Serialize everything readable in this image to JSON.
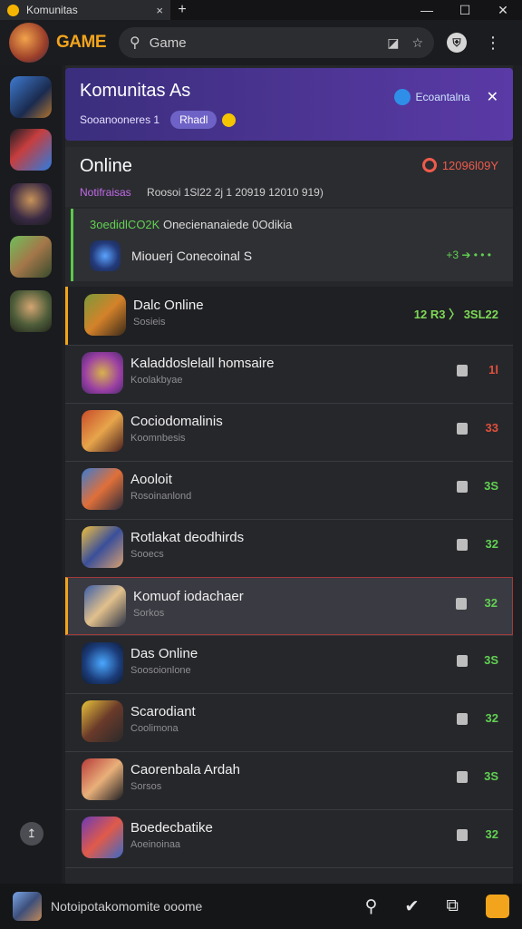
{
  "window": {
    "tab_title": "Komunitas",
    "tab_close": "×",
    "new_tab": "+",
    "minimize": "—",
    "maximize": "☐",
    "close": "✕"
  },
  "appbar": {
    "brand": "GAME",
    "search_placeholder": "Game",
    "search_icon": "search-icon",
    "shield_icon": "shield-icon",
    "menu_icon": "more-vertical-icon"
  },
  "banner": {
    "title": "Komunitas As",
    "subtitle": "Sooanooneres 1",
    "chip": "Rhadl",
    "right_label": "Ecoantalna",
    "close": "✕"
  },
  "online": {
    "title": "Online",
    "tag": "Notifraisas",
    "meta": "Roosoi 1Sl22 2j 1 20919 12010 919)",
    "status": "12096l09Y"
  },
  "notice": {
    "line1_green": "3oedidlCO2K",
    "line1_rest": "Onecienanaiede 0Odikia",
    "line2": "Miouerj Conecoinal S",
    "right": "+3 ➔ • • •"
  },
  "rows": [
    {
      "name": "Dalc Online",
      "sub": "Sosieis",
      "ind": "12 R3 〉 3SL22",
      "ind_color": "#7ed957",
      "style": "hl"
    },
    {
      "name": "Kaladdoslelall homsaire",
      "sub": "Koolakbyae",
      "ind": "1l",
      "ind_color": "#e0503c",
      "style": ""
    },
    {
      "name": "Cociodomalinis",
      "sub": "Koomnbesis",
      "ind": "33",
      "ind_color": "#e0503c",
      "style": ""
    },
    {
      "name": "Aooloit",
      "sub": "Rosoinanlond",
      "ind": "3S",
      "ind_color": "#61d152",
      "style": ""
    },
    {
      "name": "Rotlakat deodhirds",
      "sub": "Sooecs",
      "ind": "32",
      "ind_color": "#61d152",
      "style": ""
    },
    {
      "name": "Komuof iodachaer",
      "sub": "Sorkos",
      "ind": "32",
      "ind_color": "#61d152",
      "style": "sel"
    },
    {
      "name": "Das Online",
      "sub": "Soosoionlone",
      "ind": "3S",
      "ind_color": "#61d152",
      "style": ""
    },
    {
      "name": "Scarodiant",
      "sub": "Coolimona",
      "ind": "32",
      "ind_color": "#61d152",
      "style": ""
    },
    {
      "name": "Caorenbala Ardah",
      "sub": "Sorsos",
      "ind": "3S",
      "ind_color": "#61d152",
      "style": ""
    },
    {
      "name": "Boedecbatike",
      "sub": "Aoeinoinaa",
      "ind": "32",
      "ind_color": "#61d152",
      "style": ""
    }
  ],
  "bottombar": {
    "label": "Notoipotakomomite ooome"
  }
}
